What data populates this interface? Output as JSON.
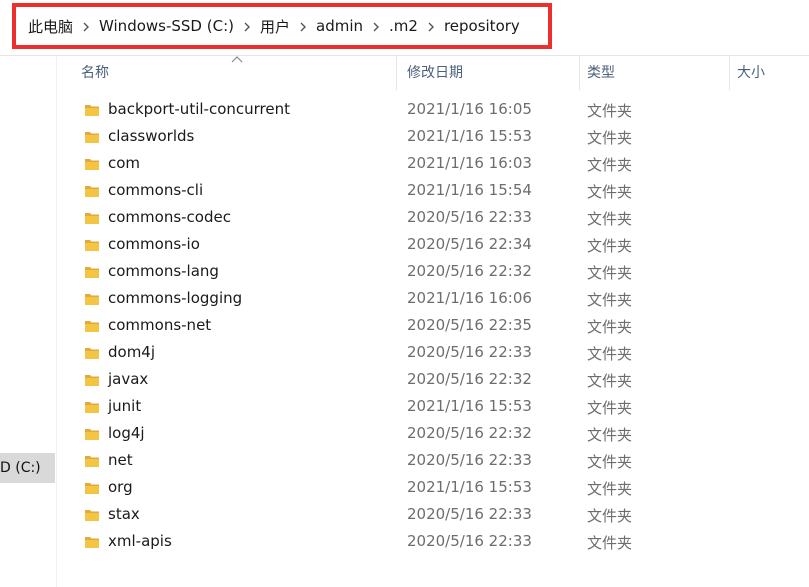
{
  "breadcrumb": {
    "items": [
      "此电脑",
      "Windows-SSD (C:)",
      "用户",
      "admin",
      ".m2",
      "repository"
    ]
  },
  "nav": {
    "selected_label": "D (C:)"
  },
  "columns": {
    "name": "名称",
    "date": "修改日期",
    "type": "类型",
    "size": "大小"
  },
  "files": [
    {
      "name": "backport-util-concurrent",
      "date": "2021/1/16 16:05",
      "type": "文件夹"
    },
    {
      "name": "classworlds",
      "date": "2021/1/16 15:53",
      "type": "文件夹"
    },
    {
      "name": "com",
      "date": "2021/1/16 16:03",
      "type": "文件夹"
    },
    {
      "name": "commons-cli",
      "date": "2021/1/16 15:54",
      "type": "文件夹"
    },
    {
      "name": "commons-codec",
      "date": "2020/5/16 22:33",
      "type": "文件夹"
    },
    {
      "name": "commons-io",
      "date": "2020/5/16 22:34",
      "type": "文件夹"
    },
    {
      "name": "commons-lang",
      "date": "2020/5/16 22:32",
      "type": "文件夹"
    },
    {
      "name": "commons-logging",
      "date": "2021/1/16 16:06",
      "type": "文件夹"
    },
    {
      "name": "commons-net",
      "date": "2020/5/16 22:35",
      "type": "文件夹"
    },
    {
      "name": "dom4j",
      "date": "2020/5/16 22:33",
      "type": "文件夹"
    },
    {
      "name": "javax",
      "date": "2020/5/16 22:32",
      "type": "文件夹"
    },
    {
      "name": "junit",
      "date": "2021/1/16 15:53",
      "type": "文件夹"
    },
    {
      "name": "log4j",
      "date": "2020/5/16 22:32",
      "type": "文件夹"
    },
    {
      "name": "net",
      "date": "2020/5/16 22:33",
      "type": "文件夹"
    },
    {
      "name": "org",
      "date": "2021/1/16 15:53",
      "type": "文件夹"
    },
    {
      "name": "stax",
      "date": "2020/5/16 22:33",
      "type": "文件夹"
    },
    {
      "name": "xml-apis",
      "date": "2020/5/16 22:33",
      "type": "文件夹"
    }
  ],
  "colors": {
    "highlight_border": "#ee2d2d",
    "folder_icon": "#f4c542",
    "header_text": "#4c607a",
    "selected_nav_bg": "#d9d9d9"
  },
  "icons": {
    "breadcrumb_separator": "chevron-right-icon",
    "file_item": "folder-icon",
    "sort_indicator": "sort-ascending-icon"
  }
}
